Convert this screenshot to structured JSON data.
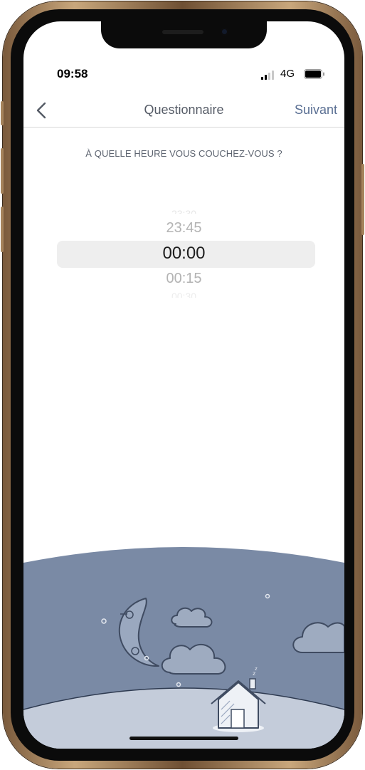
{
  "status_bar": {
    "time": "09:58",
    "network": "4G",
    "signal_icon": "signal-bars-icon",
    "battery_icon": "battery-icon"
  },
  "nav": {
    "back_icon": "chevron-left-icon",
    "title": "Questionnaire",
    "next_label": "Suivant"
  },
  "question": "À QUELLE HEURE VOUS COUCHEZ-VOUS ?",
  "time_picker": {
    "previous": "23:45",
    "selected": "00:00",
    "next": "00:15"
  },
  "illustration": {
    "description_icons": [
      "moon-icon",
      "cloud-icon",
      "house-icon",
      "star-icon"
    ],
    "colors": {
      "night_sky": "#7a8aa5",
      "ground": "#c4ccda",
      "outline": "#5d6b84"
    }
  }
}
